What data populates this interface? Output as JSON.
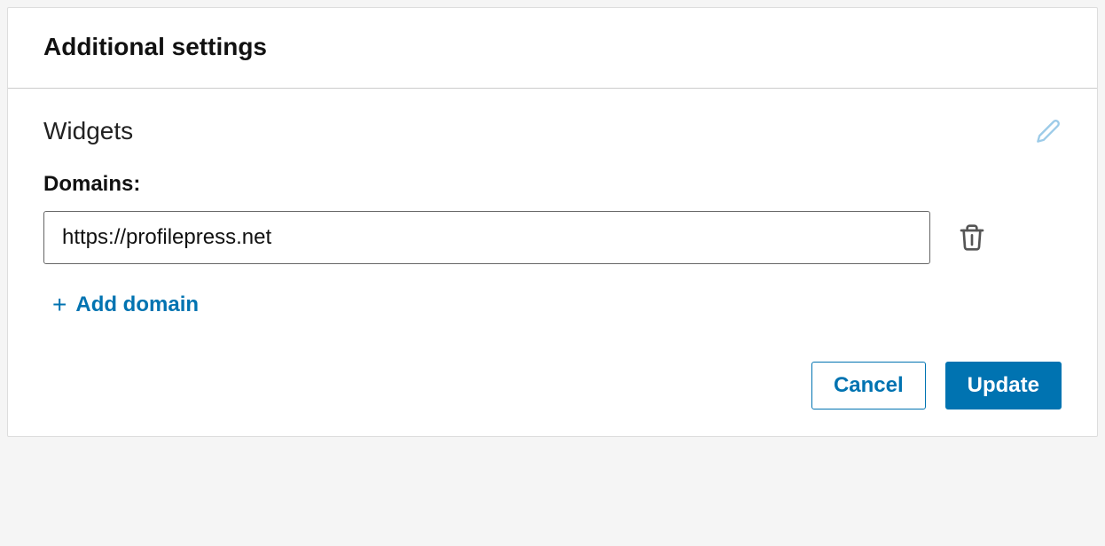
{
  "header": {
    "title": "Additional settings"
  },
  "section": {
    "title": "Widgets",
    "domains_label": "Domains:",
    "domains": [
      {
        "value": "https://profilepress.net"
      }
    ],
    "add_domain_label": "Add domain"
  },
  "buttons": {
    "cancel": "Cancel",
    "update": "Update"
  },
  "icons": {
    "edit": "pencil-icon",
    "delete": "trash-icon",
    "add": "plus-icon"
  }
}
